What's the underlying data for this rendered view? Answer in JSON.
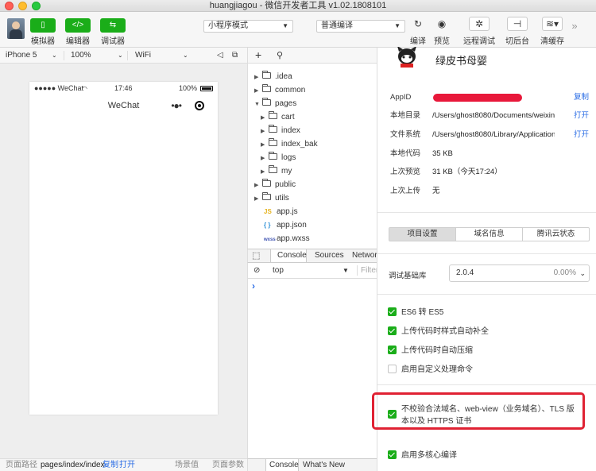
{
  "window": {
    "title": "huangjiagou - 微信开发者工具 v1.02.1808101"
  },
  "toolbar": {
    "simulator_label": "模拟器",
    "editor_label": "编辑器",
    "debugger_label": "调试器",
    "mode_select": "小程序模式",
    "compile_select": "普通编译",
    "compile_label": "编译",
    "preview_label": "预览",
    "remote_debug_label": "远程调试",
    "background_label": "切后台",
    "clear_cache_label": "清缓存"
  },
  "simulator": {
    "device": "iPhone 5",
    "zoom": "100%",
    "network": "WiFi",
    "status_carrier": "●●●●● WeChat",
    "status_time": "17:46",
    "status_battery": "100%",
    "nav_title": "WeChat",
    "nav_dots": "•●•"
  },
  "sim_footer": {
    "path_label": "页面路径",
    "path_value": "pages/index/index",
    "copy": "复制",
    "open": "打开",
    "scene": "场景值",
    "params": "页面参数"
  },
  "file_tree": {
    "items": [
      {
        "name": ".idea",
        "type": "folder"
      },
      {
        "name": "common",
        "type": "folder"
      },
      {
        "name": "pages",
        "type": "folder-open"
      },
      {
        "name": "cart",
        "type": "folder"
      },
      {
        "name": "index",
        "type": "folder"
      },
      {
        "name": "index_bak",
        "type": "folder"
      },
      {
        "name": "logs",
        "type": "folder"
      },
      {
        "name": "my",
        "type": "folder"
      },
      {
        "name": "public",
        "type": "folder"
      },
      {
        "name": "utils",
        "type": "folder"
      },
      {
        "name": "app.js",
        "type": "js"
      },
      {
        "name": "app.json",
        "type": "json"
      },
      {
        "name": "app.wxss",
        "type": "wxss"
      }
    ],
    "js_badge": "JS",
    "json_badge": "{ }",
    "wxss_badge": "wxss"
  },
  "console": {
    "tabs": [
      "Console",
      "Sources",
      "Network"
    ],
    "context": "top",
    "filter_placeholder": "Filter",
    "prompt": "›",
    "footer_tabs": [
      "Console",
      "What's New"
    ]
  },
  "details": {
    "project_name": "绿皮书母婴",
    "rows": [
      {
        "key": "AppID",
        "value": "",
        "action": "复制"
      },
      {
        "key": "本地目录",
        "value": "/Users/ghost8080/Documents/weixinxia...",
        "action": "打开"
      },
      {
        "key": "文件系统",
        "value": "/Users/ghost8080/Library/Application S...",
        "action": "打开"
      },
      {
        "key": "本地代码",
        "value": "35 KB",
        "action": ""
      },
      {
        "key": "上次预览",
        "value": "31 KB（今天17:24）",
        "action": ""
      },
      {
        "key": "上次上传",
        "value": "无",
        "action": ""
      }
    ],
    "tabs": [
      "项目设置",
      "域名信息",
      "腾讯云状态"
    ],
    "lib_label": "调试基础库",
    "lib_version": "2.0.4",
    "lib_percent": "0.00%",
    "options": [
      {
        "label": "ES6 转 ES5",
        "checked": true
      },
      {
        "label": "上传代码时样式自动补全",
        "checked": true
      },
      {
        "label": "上传代码时自动压缩",
        "checked": true
      },
      {
        "label": "启用自定义处理命令",
        "checked": false
      }
    ],
    "highlight_option": {
      "label": "不校验合法域名、web-view（业务域名）、TLS 版本以及 HTTPS 证书",
      "checked": true
    },
    "last_option": {
      "label": "启用多核心编译",
      "checked": true
    }
  },
  "colors": {
    "accent_green": "#1aad19",
    "link_blue": "#2b6de5",
    "highlight_red": "#e02233"
  }
}
